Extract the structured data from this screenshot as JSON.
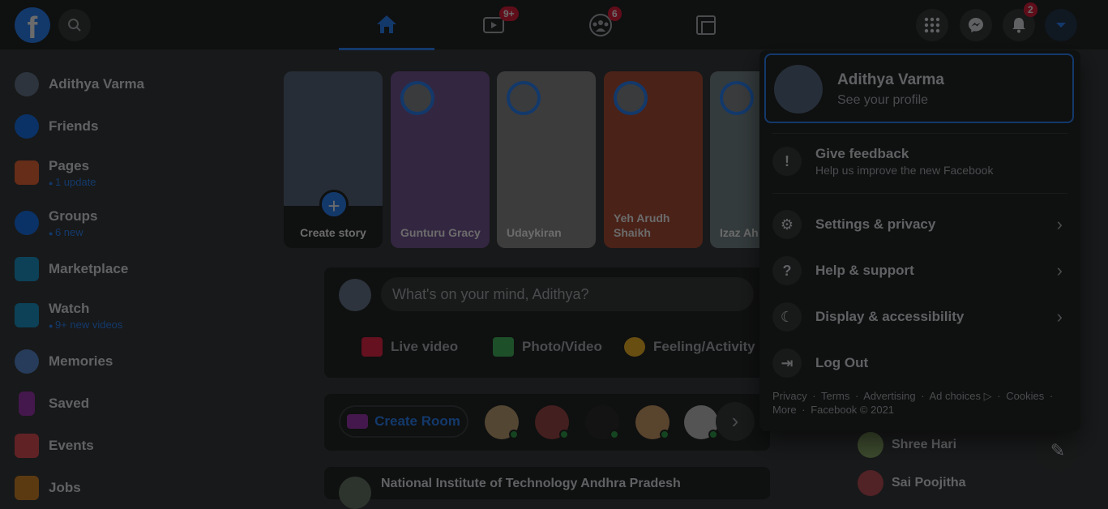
{
  "topbar": {
    "logo_letter": "f",
    "watch_badge": "9+",
    "groups_badge": "6",
    "notif_badge": "2"
  },
  "sidebar": {
    "items": [
      {
        "label": "Adithya Varma",
        "sub": ""
      },
      {
        "label": "Friends",
        "sub": ""
      },
      {
        "label": "Pages",
        "sub": "1 update"
      },
      {
        "label": "Groups",
        "sub": "6 new"
      },
      {
        "label": "Marketplace",
        "sub": ""
      },
      {
        "label": "Watch",
        "sub": "9+ new videos"
      },
      {
        "label": "Memories",
        "sub": ""
      },
      {
        "label": "Saved",
        "sub": ""
      },
      {
        "label": "Events",
        "sub": ""
      },
      {
        "label": "Jobs",
        "sub": ""
      }
    ]
  },
  "stories": {
    "create_label": "Create story",
    "plus": "+",
    "items": [
      {
        "name": "Gunturu Gracy"
      },
      {
        "name": "Udaykiran"
      },
      {
        "name": "Yeh Arudh Shaikh"
      },
      {
        "name": "Izaz Ah Shaik"
      }
    ]
  },
  "composer": {
    "placeholder": "What's on your mind, Adithya?",
    "live_video": "Live video",
    "photo_video": "Photo/Video",
    "feeling": "Feeling/Activity"
  },
  "rooms": {
    "create_room": "Create Room"
  },
  "feed": {
    "next_post_title": "National Institute of Technology Andhra Pradesh"
  },
  "menu": {
    "profile_name": "Adithya Varma",
    "profile_sub": "See your profile",
    "feedback_title": "Give feedback",
    "feedback_sub": "Help us improve the new Facebook",
    "settings": "Settings & privacy",
    "help": "Help & support",
    "display": "Display & accessibility",
    "logout": "Log Out",
    "footer": [
      "Privacy",
      "·",
      "Terms",
      "·",
      "Advertising",
      "·",
      "Ad choices ▷",
      "·",
      "Cookies",
      "·",
      "More",
      "·",
      "Facebook © 2021"
    ]
  },
  "contacts": [
    {
      "name": "Shree Hari"
    },
    {
      "name": "Sai Poojitha"
    }
  ],
  "colors": {
    "accent": "#2d88ff",
    "badge": "#e41e3f",
    "bg": "#18191a",
    "surface": "#242526"
  }
}
